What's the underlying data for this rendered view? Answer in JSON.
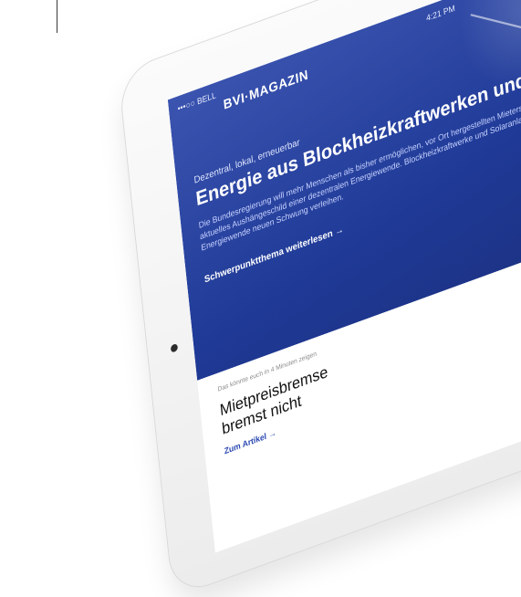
{
  "status": {
    "carrier": "•••○○ BELL",
    "time": "4:21 PM"
  },
  "header": {
    "logo": "BVI·MAGAZIN"
  },
  "hero": {
    "kicker": "Dezentral, lokal, erneuerbar",
    "headline": "Energie aus Blockheizkraftwerken und Foto",
    "body": "Die Bundesregierung will mehr Menschen als bisher ermöglichen, vor Ort hergestellten Mieterstrom gilt als aktuelles Aushängeschild einer dezentralen Energiewende. Blockheizkraftwerke und Solaranlagen geraten Energiewende neuen Schwung verleihen.",
    "cta": "Schwerpunktthema weiterlesen →"
  },
  "article": {
    "meta": "Das könnte euch in 4 Minuten zeigen",
    "title": "Mietpreisbremse bremst nicht",
    "link": "Zum Artikel →"
  }
}
